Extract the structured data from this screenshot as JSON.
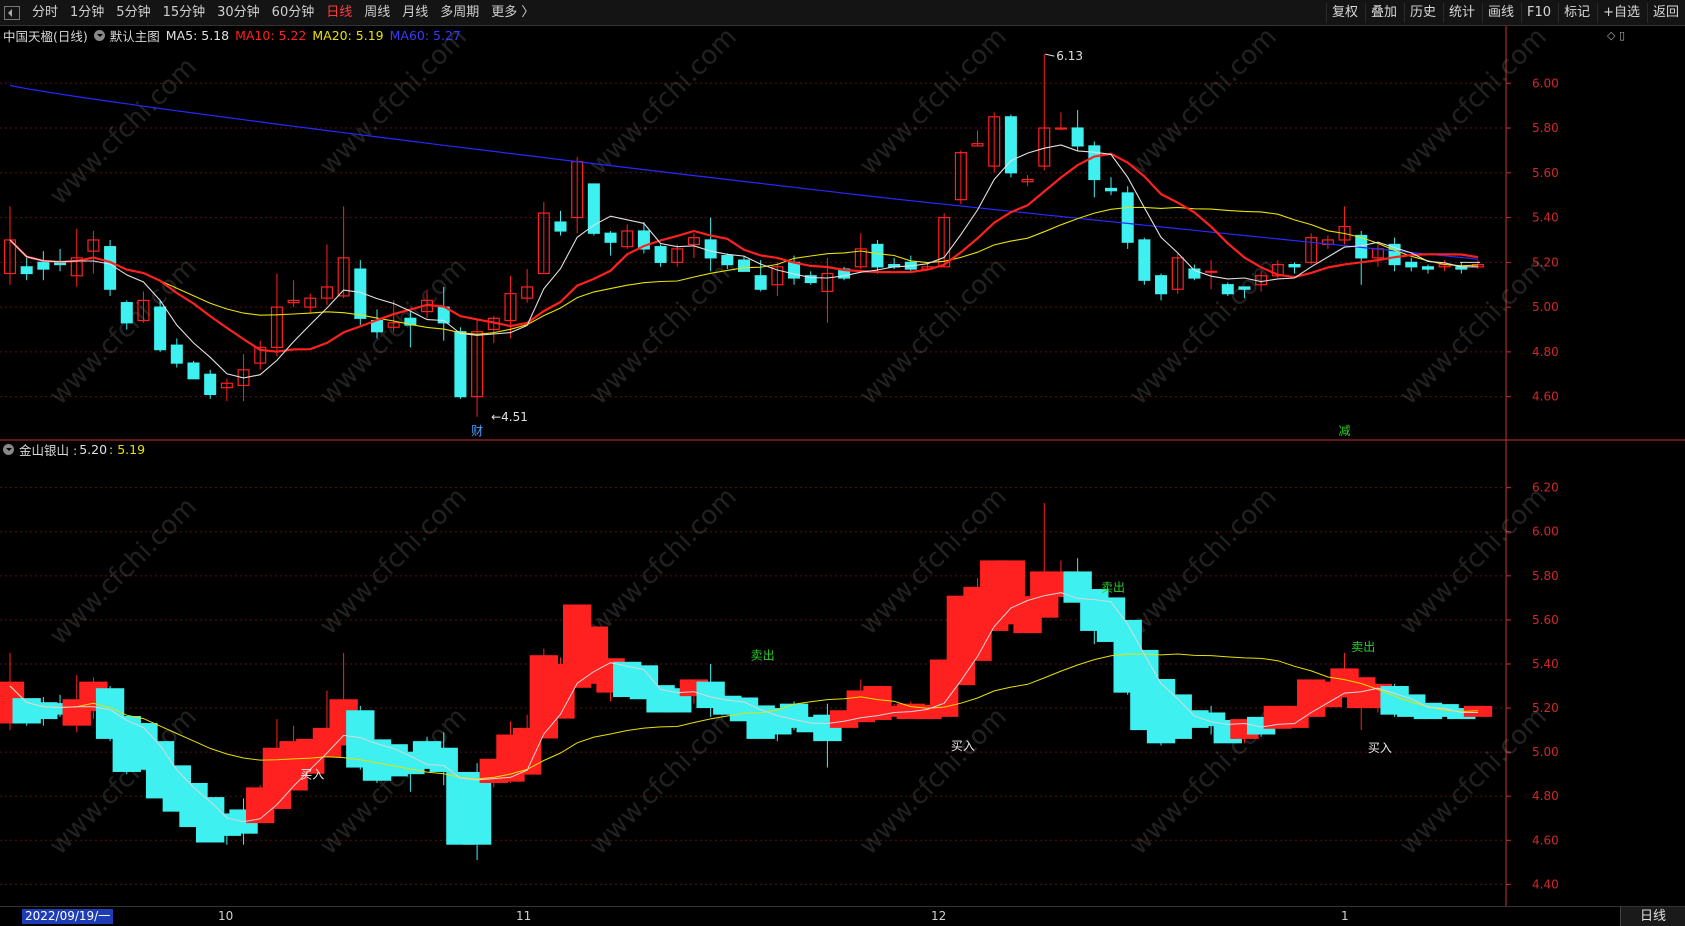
{
  "toolbar": {
    "left_items": [
      {
        "label": "分时",
        "active": false
      },
      {
        "label": "1分钟",
        "active": false
      },
      {
        "label": "5分钟",
        "active": false
      },
      {
        "label": "15分钟",
        "active": false
      },
      {
        "label": "30分钟",
        "active": false
      },
      {
        "label": "60分钟",
        "active": false
      },
      {
        "label": "日线",
        "active": true
      },
      {
        "label": "周线",
        "active": false
      },
      {
        "label": "月线",
        "active": false
      },
      {
        "label": "多周期",
        "active": false
      },
      {
        "label": "更多 〉",
        "active": false
      }
    ],
    "right_items": [
      "复权",
      "叠加",
      "历史",
      "统计",
      "画线",
      "F10",
      "标记",
      "+自选",
      "返回"
    ]
  },
  "main_legend": {
    "title": "中国天楹(日线)",
    "template": "默认主图",
    "ma5": "MA5: 5.18",
    "ma10": "MA10: 5.22",
    "ma20": "MA20: 5.19",
    "ma60": "MA60: 5.27"
  },
  "sub_legend": {
    "name": "金山银山 :",
    "v1": "5.20",
    "v2": ": 5.19"
  },
  "colors": {
    "up": "#ff2020",
    "down": "#3ff0f0",
    "ma5": "#e0e0e0",
    "ma10": "#ff2020",
    "ma20": "#e8e000",
    "ma60": "#2828ff",
    "axis": "#c83030",
    "grid": "#5a1010"
  },
  "main_axis": {
    "ticks": [
      "6.00",
      "5.80",
      "5.60",
      "5.40",
      "5.20",
      "5.00",
      "4.80",
      "4.60"
    ]
  },
  "sub_axis": {
    "ticks": [
      "6.20",
      "6.00",
      "5.80",
      "5.60",
      "5.40",
      "5.20",
      "5.00",
      "4.80",
      "4.60",
      "4.40"
    ]
  },
  "annotations": {
    "high": "6.13",
    "low": "4.51",
    "cai": "财",
    "jian": "减"
  },
  "signals": [
    {
      "text": "买入",
      "color": "white"
    },
    {
      "text": "卖出",
      "color": "green"
    },
    {
      "text": "买入",
      "color": "white"
    },
    {
      "text": "卖出",
      "color": "green"
    },
    {
      "text": "卖出",
      "color": "green"
    },
    {
      "text": "买入",
      "color": "white"
    }
  ],
  "watermark": "www.cfchi.com",
  "footer": {
    "date": "2022/09/19/一",
    "x_labels": [
      "10",
      "11",
      "12",
      "1"
    ],
    "period_button": "日线"
  },
  "chart_data": {
    "type": "candlestick",
    "ylim_main": [
      4.46,
      6.22
    ],
    "ylim_sub": [
      4.32,
      6.38
    ],
    "candles": [
      [
        5.15,
        5.3,
        5.45,
        5.1
      ],
      [
        5.18,
        5.15,
        5.22,
        5.12
      ],
      [
        5.2,
        5.17,
        5.25,
        5.12
      ],
      [
        5.2,
        5.19,
        5.26,
        5.16
      ],
      [
        5.14,
        5.22,
        5.35,
        5.09
      ],
      [
        5.25,
        5.3,
        5.34,
        5.15
      ],
      [
        5.27,
        5.08,
        5.3,
        5.05
      ],
      [
        5.02,
        4.93,
        5.03,
        4.9
      ],
      [
        4.94,
        5.03,
        5.07,
        4.93
      ],
      [
        5.0,
        4.81,
        5.03,
        4.8
      ],
      [
        4.83,
        4.75,
        4.86,
        4.73
      ],
      [
        4.75,
        4.68,
        4.76,
        4.68
      ],
      [
        4.7,
        4.61,
        4.72,
        4.59
      ],
      [
        4.64,
        4.66,
        4.68,
        4.58
      ],
      [
        4.65,
        4.72,
        4.79,
        4.58
      ],
      [
        4.75,
        4.82,
        4.85,
        4.72
      ],
      [
        4.82,
        5.0,
        5.15,
        4.78
      ],
      [
        5.02,
        5.03,
        5.12,
        5.0
      ],
      [
        5.0,
        5.04,
        5.06,
        4.97
      ],
      [
        5.04,
        5.09,
        5.28,
        5.01
      ],
      [
        5.05,
        5.22,
        5.45,
        5.04
      ],
      [
        5.17,
        4.95,
        5.21,
        4.92
      ],
      [
        4.94,
        4.89,
        4.99,
        4.86
      ],
      [
        4.91,
        4.93,
        5.03,
        4.89
      ],
      [
        4.95,
        4.92,
        4.98,
        4.82
      ],
      [
        4.98,
        5.03,
        5.07,
        4.95
      ],
      [
        5.0,
        4.93,
        5.09,
        4.85
      ],
      [
        4.89,
        4.6,
        4.91,
        4.59
      ],
      [
        4.6,
        4.89,
        4.95,
        4.51
      ],
      [
        4.9,
        4.95,
        4.96,
        4.84
      ],
      [
        4.94,
        5.06,
        5.14,
        4.86
      ],
      [
        5.04,
        5.09,
        5.17,
        5.02
      ],
      [
        5.15,
        5.42,
        5.47,
        5.15
      ],
      [
        5.38,
        5.34,
        5.43,
        5.32
      ],
      [
        5.4,
        5.65,
        5.67,
        5.33
      ],
      [
        5.55,
        5.33,
        5.55,
        5.32
      ],
      [
        5.33,
        5.29,
        5.34,
        5.23
      ],
      [
        5.27,
        5.34,
        5.37,
        5.26
      ],
      [
        5.34,
        5.26,
        5.38,
        5.24
      ],
      [
        5.27,
        5.2,
        5.28,
        5.18
      ],
      [
        5.2,
        5.26,
        5.28,
        5.18
      ],
      [
        5.28,
        5.31,
        5.33,
        5.22
      ],
      [
        5.3,
        5.22,
        5.4,
        5.16
      ],
      [
        5.23,
        5.19,
        5.24,
        5.17
      ],
      [
        5.21,
        5.16,
        5.23,
        5.16
      ],
      [
        5.14,
        5.08,
        5.21,
        5.07
      ],
      [
        5.1,
        5.18,
        5.2,
        5.05
      ],
      [
        5.2,
        5.13,
        5.23,
        5.1
      ],
      [
        5.14,
        5.11,
        5.16,
        5.1
      ],
      [
        5.07,
        5.15,
        5.22,
        4.93
      ],
      [
        5.17,
        5.13,
        5.18,
        5.12
      ],
      [
        5.18,
        5.26,
        5.33,
        5.17
      ],
      [
        5.28,
        5.18,
        5.3,
        5.15
      ],
      [
        5.19,
        5.18,
        5.22,
        5.17
      ],
      [
        5.2,
        5.17,
        5.23,
        5.16
      ],
      [
        5.17,
        5.18,
        5.2,
        5.17
      ],
      [
        5.18,
        5.4,
        5.42,
        5.18
      ],
      [
        5.48,
        5.69,
        5.7,
        5.46
      ],
      [
        5.72,
        5.73,
        5.79,
        5.72
      ],
      [
        5.63,
        5.85,
        5.87,
        5.6
      ],
      [
        5.85,
        5.6,
        5.86,
        5.58
      ],
      [
        5.56,
        5.57,
        5.59,
        5.54
      ],
      [
        5.63,
        5.8,
        6.13,
        5.61
      ],
      [
        5.8,
        5.8,
        5.87,
        5.79
      ],
      [
        5.8,
        5.72,
        5.88,
        5.7
      ],
      [
        5.72,
        5.57,
        5.74,
        5.49
      ],
      [
        5.53,
        5.52,
        5.58,
        5.5
      ],
      [
        5.51,
        5.29,
        5.54,
        5.26
      ],
      [
        5.3,
        5.12,
        5.31,
        5.1
      ],
      [
        5.14,
        5.06,
        5.15,
        5.03
      ],
      [
        5.08,
        5.22,
        5.24,
        5.06
      ],
      [
        5.17,
        5.13,
        5.19,
        5.12
      ],
      [
        5.16,
        5.16,
        5.21,
        5.08
      ],
      [
        5.1,
        5.06,
        5.11,
        5.05
      ],
      [
        5.09,
        5.08,
        5.09,
        5.04
      ],
      [
        5.1,
        5.14,
        5.16,
        5.07
      ],
      [
        5.14,
        5.19,
        5.21,
        5.13
      ],
      [
        5.19,
        5.18,
        5.2,
        5.15
      ],
      [
        5.2,
        5.31,
        5.33,
        5.19
      ],
      [
        5.28,
        5.3,
        5.32,
        5.26
      ],
      [
        5.3,
        5.36,
        5.45,
        5.28
      ],
      [
        5.32,
        5.22,
        5.34,
        5.1
      ],
      [
        5.22,
        5.26,
        5.28,
        5.18
      ],
      [
        5.28,
        5.19,
        5.31,
        5.16
      ],
      [
        5.2,
        5.18,
        5.22,
        5.16
      ],
      [
        5.18,
        5.17,
        5.19,
        5.15
      ],
      [
        5.18,
        5.19,
        5.21,
        5.16
      ],
      [
        5.18,
        5.17,
        5.2,
        5.15
      ],
      [
        5.18,
        5.19,
        5.21,
        5.17
      ]
    ]
  }
}
